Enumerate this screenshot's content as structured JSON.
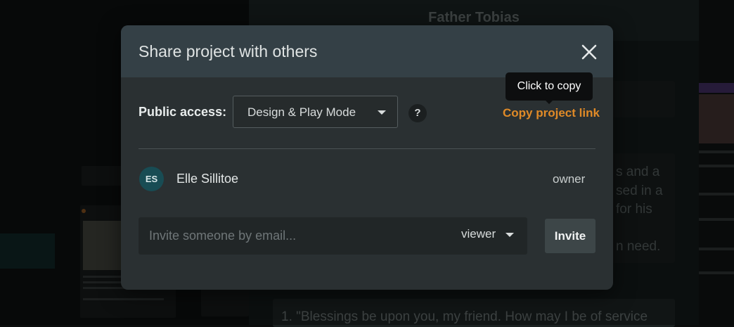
{
  "background": {
    "character_title": "Father Tobias",
    "text_lines": [
      "s and a",
      "sed in a",
      "for his",
      "n need."
    ],
    "bottom_line": "1. \"Blessings be upon you, my friend. How may I be of service"
  },
  "modal": {
    "title": "Share project with others",
    "close_icon": "close-icon",
    "public_access": {
      "label": "Public access:",
      "selected": "Design & Play Mode",
      "help": "?"
    },
    "tooltip": "Click to copy",
    "copy_link_label": "Copy project link",
    "members": [
      {
        "initials": "ES",
        "name": "Elle Sillitoe",
        "role": "owner"
      }
    ],
    "invite": {
      "placeholder": "Invite someone by email...",
      "role": "viewer",
      "button_label": "Invite"
    }
  },
  "colors": {
    "accent_link": "#e08a27",
    "avatar_bg": "#184c54",
    "modal_bg": "#2a3032",
    "modal_header_bg": "#344046"
  }
}
